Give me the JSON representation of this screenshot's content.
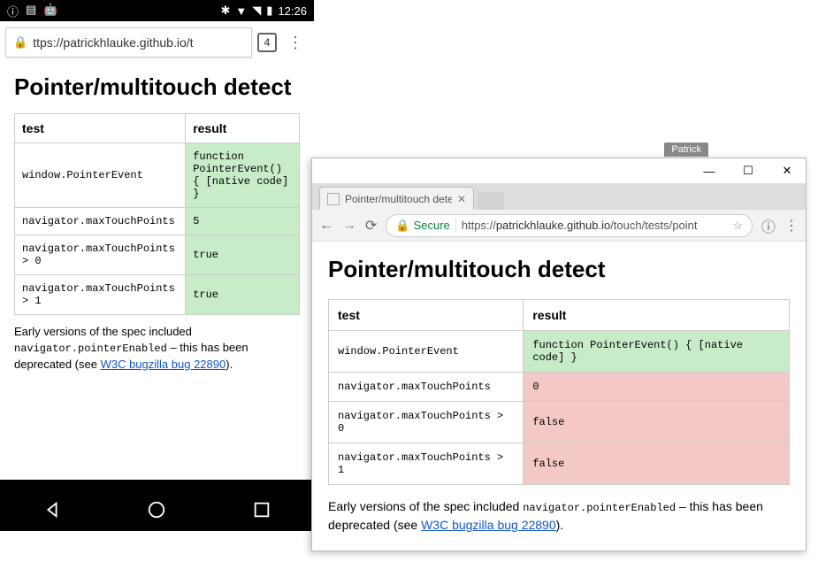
{
  "mobile": {
    "statusbar": {
      "time": "12:26"
    },
    "url": "ttps://patrickhlauke.github.io/t",
    "tab_count": "4",
    "page": {
      "title": "Pointer/multitouch detect",
      "table": {
        "headers": [
          "test",
          "result"
        ],
        "rows": [
          {
            "test": "window.PointerEvent",
            "result": "function PointerEvent() { [native code] }",
            "status": "pass"
          },
          {
            "test": "navigator.maxTouchPoints",
            "result": "5",
            "status": "pass"
          },
          {
            "test": "navigator.maxTouchPoints > 0",
            "result": "true",
            "status": "pass"
          },
          {
            "test": "navigator.maxTouchPoints > 1",
            "result": "true",
            "status": "pass"
          }
        ]
      },
      "note_prefix": "Early versions of the spec included ",
      "note_code": "navigator.pointerEnabled",
      "note_mid": " – this has been deprecated (see ",
      "note_link": "W3C bugzilla bug 22890",
      "note_suffix": ")."
    }
  },
  "desktop": {
    "titlebar_label": "Patrick",
    "tab_title": "Pointer/multitouch detec",
    "secure_label": "Secure",
    "url_prefix": "https://",
    "url_domain": "patrickhlauke.github.io",
    "url_path": "/touch/tests/point",
    "page": {
      "title": "Pointer/multitouch detect",
      "table": {
        "headers": [
          "test",
          "result"
        ],
        "rows": [
          {
            "test": "window.PointerEvent",
            "result": "function PointerEvent() { [native code] }",
            "status": "pass"
          },
          {
            "test": "navigator.maxTouchPoints",
            "result": "0",
            "status": "fail"
          },
          {
            "test": "navigator.maxTouchPoints > 0",
            "result": "false",
            "status": "fail"
          },
          {
            "test": "navigator.maxTouchPoints > 1",
            "result": "false",
            "status": "fail"
          }
        ]
      },
      "note_prefix": "Early versions of the spec included ",
      "note_code": "navigator.pointerEnabled",
      "note_mid": " – this has been deprecated (see ",
      "note_link": "W3C bugzilla bug 22890",
      "note_suffix": ")."
    }
  }
}
